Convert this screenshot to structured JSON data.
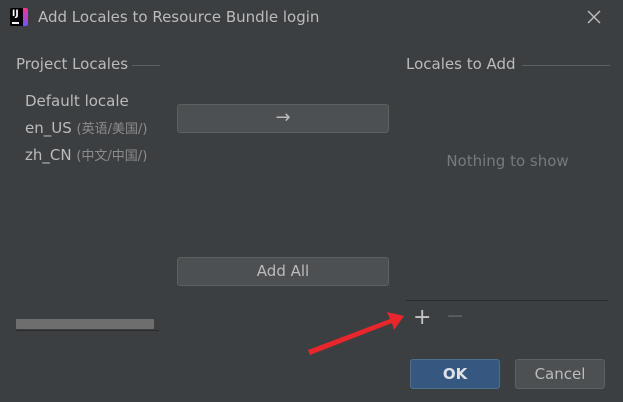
{
  "window": {
    "title": "Add Locales to Resource Bundle login",
    "app_icon": "intellij-idea-icon",
    "close_icon": "close-icon"
  },
  "project_locales": {
    "title": "Project Locales",
    "items": [
      {
        "name": "Default locale",
        "detail": ""
      },
      {
        "name": "en_US",
        "detail": "(英语/美国/)"
      },
      {
        "name": "zh_CN",
        "detail": "(中文/中国/)"
      }
    ]
  },
  "move_button": {
    "label": "→",
    "icon": "arrow-right-icon"
  },
  "add_all_button": {
    "label": "Add All"
  },
  "locales_to_add": {
    "title": "Locales to Add",
    "empty_text": "Nothing to show",
    "add_icon": "plus-icon",
    "add_label": "+",
    "remove_icon": "minus-icon",
    "remove_label": "−"
  },
  "footer": {
    "ok_label": "OK",
    "cancel_label": "Cancel"
  },
  "annotation": {
    "color": "#e8262b",
    "icon": "red-arrow-annotation"
  },
  "colors": {
    "background": "#3c3f41",
    "text": "#bbbbbb",
    "primary_button": "#365880"
  }
}
